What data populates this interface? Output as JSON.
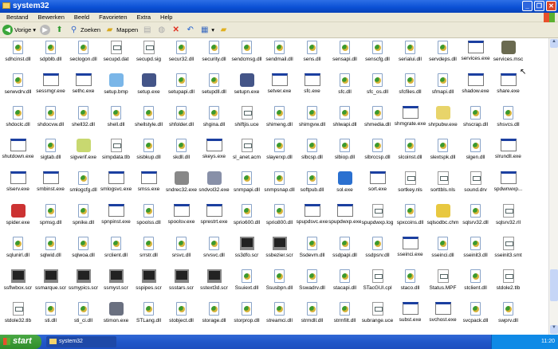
{
  "window": {
    "title": "system32",
    "controls": [
      "_",
      "❐",
      "✕"
    ]
  },
  "menu": [
    "Bestand",
    "Bewerken",
    "Beeld",
    "Favorieten",
    "Extra",
    "Help"
  ],
  "toolbar": {
    "back": "Vorige",
    "search": "Zoeken",
    "folders": "Mappen"
  },
  "colors": {
    "titlebar": "#0a4fd4",
    "taskbar": "#2157c9",
    "start": "#3a9a35"
  },
  "files": [
    [
      [
        "sdhcinst.dll",
        "dll"
      ],
      [
        "sdpblb.dll",
        "dll"
      ],
      [
        "seclogon.dll",
        "dll"
      ],
      [
        "secupd.dat",
        "txt"
      ],
      [
        "secupd.sig",
        "txt"
      ],
      [
        "secur32.dll",
        "dll"
      ],
      [
        "security.dll",
        "dll"
      ],
      [
        "sendcmsg.dll",
        "dll"
      ],
      [
        "sendmail.dll",
        "dll"
      ],
      [
        "sens.dll",
        "dll"
      ],
      [
        "sensapi.dll",
        "dll"
      ],
      [
        "senscfg.dll",
        "dll"
      ],
      [
        "serialui.dll",
        "dll"
      ],
      [
        "servdeps.dll",
        "dll"
      ],
      [
        "services.exe",
        "exe"
      ],
      [
        "services.msc",
        "gears"
      ]
    ],
    [
      [
        "serwvdrv.dll",
        "dll"
      ],
      [
        "sessmgr.exe",
        "exe"
      ],
      [
        "sethc.exe",
        "exe"
      ],
      [
        "setup.bmp",
        "bmp"
      ],
      [
        "setup.exe",
        "setup"
      ],
      [
        "setupapi.dll",
        "dll"
      ],
      [
        "setupdll.dll",
        "dll"
      ],
      [
        "setupn.exe",
        "setup"
      ],
      [
        "setver.exe",
        "exe"
      ],
      [
        "sfc.exe",
        "exe"
      ],
      [
        "sfc.dll",
        "dll"
      ],
      [
        "sfc_os.dll",
        "dll"
      ],
      [
        "sfcfiles.dll",
        "dll"
      ],
      [
        "sfmapi.dll",
        "dll"
      ],
      [
        "shadow.exe",
        "exe"
      ],
      [
        "share.exe",
        "exe"
      ]
    ],
    [
      [
        "shdoclc.dll",
        "dll"
      ],
      [
        "shdocvw.dll",
        "dll"
      ],
      [
        "shell32.dll",
        "dll"
      ],
      [
        "shell.dll",
        "dll"
      ],
      [
        "shellstyle.dll",
        "dll"
      ],
      [
        "shfolder.dll",
        "dll"
      ],
      [
        "shgina.dll",
        "dll"
      ],
      [
        "shiftjis.uce",
        "txt"
      ],
      [
        "shimeng.dll",
        "dll"
      ],
      [
        "shimgvw.dll",
        "dll"
      ],
      [
        "shlwapi.dll",
        "dll"
      ],
      [
        "shmedia.dll",
        "dll"
      ],
      [
        "shmgrate.exe",
        "exe"
      ],
      [
        "shrpubw.exe",
        "folder"
      ],
      [
        "shscrap.dll",
        "dll"
      ],
      [
        "shsvcs.dll",
        "dll"
      ]
    ],
    [
      [
        "shutdown.exe",
        "exe"
      ],
      [
        "sigtab.dll",
        "dll"
      ],
      [
        "sigverif.exe",
        "sigverif"
      ],
      [
        "simpdata.tlb",
        "txt"
      ],
      [
        "sisbkup.dll",
        "dll"
      ],
      [
        "skdll.dll",
        "dll"
      ],
      [
        "skeys.exe",
        "exe"
      ],
      [
        "sl_anet.acm",
        "txt"
      ],
      [
        "slayerxp.dll",
        "dll"
      ],
      [
        "slbcsp.dll",
        "dll"
      ],
      [
        "slbiop.dll",
        "dll"
      ],
      [
        "slbrccsp.dll",
        "dll"
      ],
      [
        "slcoinst.dll",
        "dll"
      ],
      [
        "slextspk.dll",
        "dll"
      ],
      [
        "slgen.dll",
        "dll"
      ],
      [
        "slrundll.exe",
        "exe"
      ]
    ],
    [
      [
        "slserv.exe",
        "exe"
      ],
      [
        "smbinst.exe",
        "exe"
      ],
      [
        "smlogcfg.dll",
        "dll"
      ],
      [
        "smlogsvc.exe",
        "exe"
      ],
      [
        "smss.exe",
        "exe"
      ],
      [
        "sndrec32.exe",
        "speaker"
      ],
      [
        "sndvol32.exe",
        "sndvol"
      ],
      [
        "snmpapi.dll",
        "dll"
      ],
      [
        "snmpsnap.dll",
        "dll"
      ],
      [
        "softpub.dll",
        "dll"
      ],
      [
        "sol.exe",
        "sol"
      ],
      [
        "sort.exe",
        "exe"
      ],
      [
        "sortkey.nls",
        "txt"
      ],
      [
        "sorttbls.nls",
        "txt"
      ],
      [
        "sound.drv",
        "txt"
      ],
      [
        "spdwnwxp...",
        "exe"
      ]
    ],
    [
      [
        "spider.exe",
        "spider"
      ],
      [
        "spmsg.dll",
        "dll"
      ],
      [
        "spnike.dll",
        "dll"
      ],
      [
        "spnpinst.exe",
        "exe"
      ],
      [
        "spoolss.dll",
        "dll"
      ],
      [
        "spoolsv.exe",
        "exe"
      ],
      [
        "sprestrt.exe",
        "exe"
      ],
      [
        "sprio600.dll",
        "dll"
      ],
      [
        "sprio800.dll",
        "dll"
      ],
      [
        "spupdsvc.exe",
        "exe"
      ],
      [
        "spupdwxp.exe",
        "exe"
      ],
      [
        "spupdwxp.log",
        "txt"
      ],
      [
        "spxcoins.dll",
        "dll"
      ],
      [
        "sqlsodbc.chm",
        "chm"
      ],
      [
        "sqlsrv32.dll",
        "dll"
      ],
      [
        "sqlsrv32.rll",
        "txt"
      ]
    ],
    [
      [
        "sqlunirl.dll",
        "dll"
      ],
      [
        "sqlwid.dll",
        "dll"
      ],
      [
        "sqlwoa.dll",
        "dll"
      ],
      [
        "srclient.dll",
        "dll"
      ],
      [
        "srrstr.dll",
        "dll"
      ],
      [
        "srsvc.dll",
        "dll"
      ],
      [
        "srvsvc.dll",
        "dll"
      ],
      [
        "ss3dfo.scr",
        "scr"
      ],
      [
        "ssbezier.scr",
        "scr"
      ],
      [
        "Ssdevm.dll",
        "dll"
      ],
      [
        "ssdpapi.dll",
        "dll"
      ],
      [
        "ssdpsrv.dll",
        "dll"
      ],
      [
        "sseinci.exe",
        "exe"
      ],
      [
        "sseinci.dll",
        "dll"
      ],
      [
        "sseinit3.dll",
        "dll"
      ],
      [
        "sseinit3.smt",
        "txt"
      ]
    ],
    [
      [
        "ssflwbox.scr",
        "scr"
      ],
      [
        "ssmarque.scr",
        "scr"
      ],
      [
        "ssmypics.scr",
        "scr"
      ],
      [
        "ssmyst.scr",
        "scr"
      ],
      [
        "sspipes.scr",
        "scr"
      ],
      [
        "ssstars.scr",
        "scr"
      ],
      [
        "sstext3d.scr",
        "scr"
      ],
      [
        "Ssuiext.dll",
        "dll"
      ],
      [
        "Ssusbpn.dll",
        "dll"
      ],
      [
        "Sswadrv.dll",
        "dll"
      ],
      [
        "stacapi.dll",
        "dll"
      ],
      [
        "STacGUI.cpl",
        "txt"
      ],
      [
        "staco.dll",
        "dll"
      ],
      [
        "Status.MPF",
        "txt"
      ],
      [
        "stclient.dll",
        "dll"
      ],
      [
        "stdole2.tlb",
        "txt"
      ]
    ],
    [
      [
        "stdole32.tlb",
        "txt"
      ],
      [
        "sti.dll",
        "dll"
      ],
      [
        "sti_ci.dll",
        "dll"
      ],
      [
        "stimon.exe",
        "stimon"
      ],
      [
        "STLang.dll",
        "dll"
      ],
      [
        "stobject.dll",
        "dll"
      ],
      [
        "storage.dll",
        "dll"
      ],
      [
        "storprop.dll",
        "dll"
      ],
      [
        "streamci.dll",
        "dll"
      ],
      [
        "strmdll.dll",
        "dll"
      ],
      [
        "strmfilt.dll",
        "dll"
      ],
      [
        "subrange.uce",
        "txt"
      ],
      [
        "subst.exe",
        "exe"
      ],
      [
        "svchost.exe",
        "exe"
      ],
      [
        "svcpack.dll",
        "dll"
      ],
      [
        "swprv.dll",
        "dll"
      ]
    ]
  ],
  "taskbar": {
    "start": "start",
    "task": "system32",
    "clock": "11:20"
  }
}
